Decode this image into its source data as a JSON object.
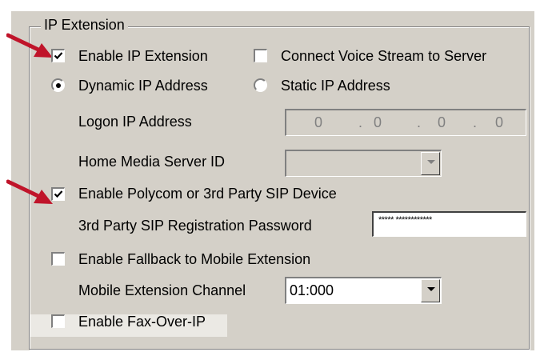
{
  "group": {
    "title": "IP Extension"
  },
  "enable_ip_extension": {
    "label": "Enable IP Extension",
    "checked": true
  },
  "connect_voice_stream": {
    "label": "Connect Voice Stream to Server",
    "checked": false
  },
  "dynamic_ip": {
    "label": "Dynamic IP Address",
    "selected": true
  },
  "static_ip": {
    "label": "Static IP Address",
    "selected": false
  },
  "logon_ip": {
    "label": "Logon IP Address",
    "octets": [
      "0",
      "0",
      "0",
      "0"
    ],
    "separator": "."
  },
  "home_media_server": {
    "label": "Home Media Server ID",
    "value": ""
  },
  "enable_polycom": {
    "label": "Enable Polycom or 3rd Party SIP Device",
    "checked": true
  },
  "sip_password": {
    "label": "3rd Party SIP Registration Password",
    "value": "***** ************"
  },
  "enable_fallback": {
    "label": "Enable Fallback to Mobile Extension",
    "checked": false
  },
  "mobile_channel": {
    "label": "Mobile Extension Channel",
    "value": "01:000"
  },
  "enable_fax": {
    "label": "Enable Fax-Over-IP",
    "checked": false
  },
  "colors": {
    "panel": "#d4d0c8",
    "arrow": "#c0142a"
  }
}
